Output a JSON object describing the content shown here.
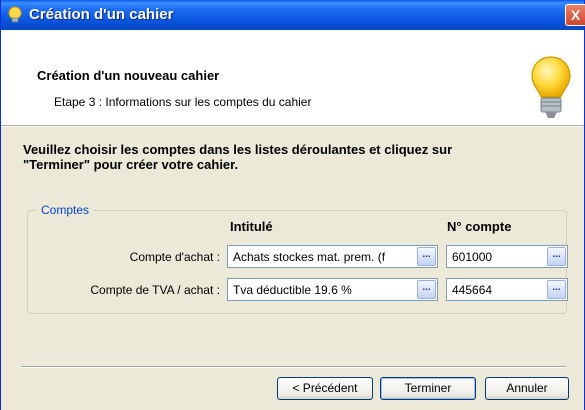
{
  "window": {
    "title": "Création d'un cahier",
    "close_label": "X"
  },
  "header": {
    "title": "Création d'un nouveau cahier",
    "subtitle": "Etape 3 : Informations sur les comptes du cahier"
  },
  "instructions": {
    "line1": "Veuillez choisir les comptes dans les listes déroulantes et cliquez sur",
    "line2": "\"Terminer\" pour créer votre cahier."
  },
  "accounts": {
    "legend": "Comptes",
    "col_label": "Intitulé",
    "col_number": "N° compte",
    "rows": [
      {
        "label": "Compte d'achat :",
        "label_value": "Achats stockes mat. prem. (f",
        "number": "601000"
      },
      {
        "label": "Compte de TVA / achat :",
        "label_value": "Tva déductible 19.6 %",
        "number": "445664"
      }
    ],
    "lookup_glyph": "..."
  },
  "buttons": {
    "previous": "< Précédent",
    "finish": "Terminer",
    "cancel": "Annuler"
  },
  "colors": {
    "titlebar": "#0855dd",
    "window_bg": "#ece9d8",
    "legend_text": "#0046d5",
    "close_button": "#d0462c"
  },
  "icons": {
    "title": "lightbulb-icon",
    "header": "lightbulb-icon",
    "close": "close-icon"
  }
}
